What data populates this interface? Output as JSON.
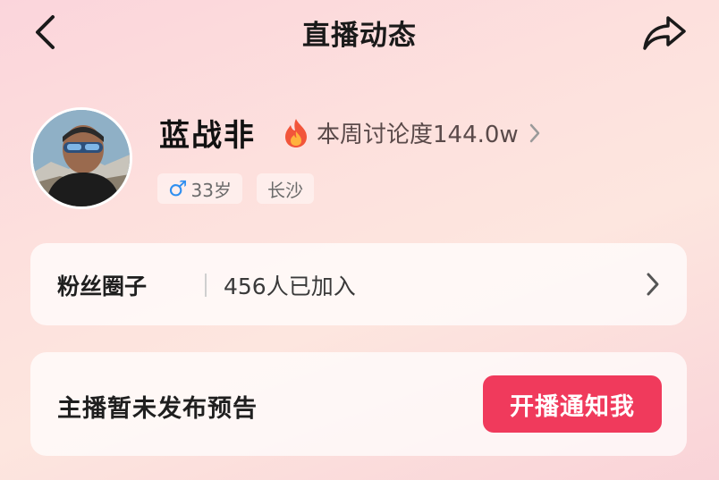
{
  "header": {
    "title": "直播动态",
    "back_icon": "chevron-left-icon",
    "share_icon": "share-arrow-icon"
  },
  "profile": {
    "name": "蓝战非",
    "heat_label": "本周讨论度144.0w",
    "heat_icon": "flame-icon",
    "tags": {
      "gender_symbol": "♂",
      "age": "33岁",
      "city": "长沙"
    }
  },
  "fan_circle": {
    "title": "粉丝圈子",
    "count_text": "456人已加入"
  },
  "notice": {
    "text": "主播暂未发布预告",
    "button_label": "开播通知我"
  },
  "colors": {
    "accent": "#f03a5c",
    "male": "#2f8ff0",
    "flame_outer": "#f2553a",
    "flame_inner": "#ffb23d"
  }
}
